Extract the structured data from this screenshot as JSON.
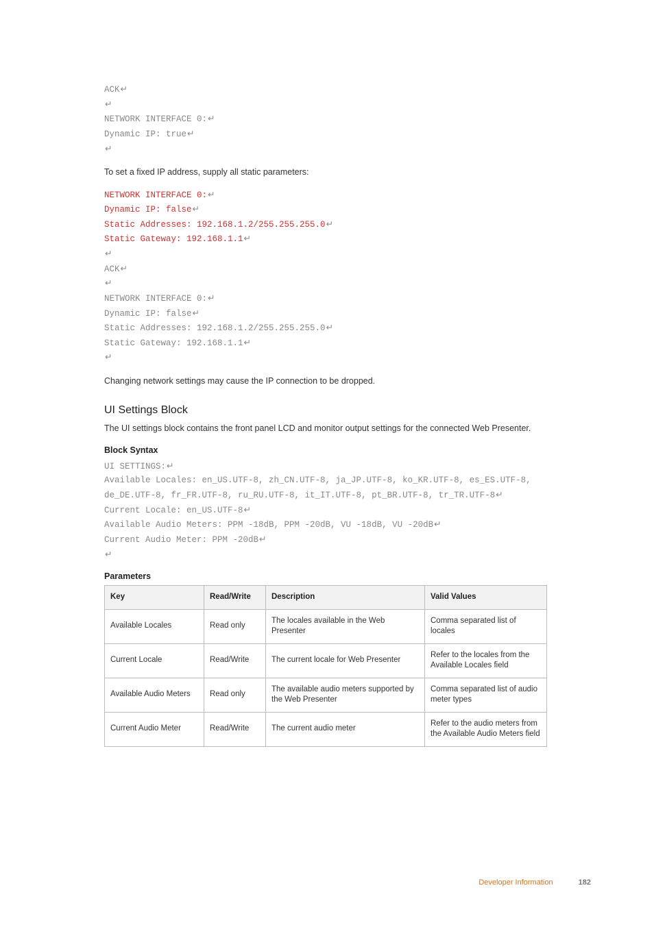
{
  "code_block_1": [
    {
      "text": "ACK",
      "cr": true
    },
    {
      "text": "",
      "cr": true
    },
    {
      "text": "NETWORK INTERFACE 0:",
      "cr": true
    },
    {
      "text": "Dynamic IP: true",
      "cr": true
    },
    {
      "text": "",
      "cr": true
    }
  ],
  "para_1": "To set a fixed IP address, supply all static parameters:",
  "code_block_2": [
    {
      "text": "NETWORK INTERFACE 0:",
      "cr": true,
      "red": true
    },
    {
      "text": "Dynamic IP: false",
      "cr": true,
      "red": true
    },
    {
      "text": "Static Addresses: 192.168.1.2/255.255.255.0",
      "cr": true,
      "red": true
    },
    {
      "text": "Static Gateway: 192.168.1.1",
      "cr": true,
      "red": true
    },
    {
      "text": "",
      "cr": true,
      "red": true
    },
    {
      "text": "ACK",
      "cr": true
    },
    {
      "text": "",
      "cr": true
    },
    {
      "text": "NETWORK INTERFACE 0:",
      "cr": true
    },
    {
      "text": "Dynamic IP: false",
      "cr": true
    },
    {
      "text": "Static Addresses: 192.168.1.2/255.255.255.0",
      "cr": true
    },
    {
      "text": "Static Gateway: 192.168.1.1",
      "cr": true
    },
    {
      "text": "",
      "cr": true
    }
  ],
  "para_2": "Changing network settings may cause the IP connection to be dropped.",
  "heading_ui": "UI Settings Block",
  "para_3": "The UI settings block contains the front panel LCD and monitor output settings for the connected Web Presenter.",
  "block_syntax_label": "Block Syntax",
  "code_block_3": [
    {
      "text": "UI SETTINGS:",
      "cr": true
    },
    {
      "text": "Available Locales: en_US.UTF-8, zh_CN.UTF-8, ja_JP.UTF-8, ko_KR.UTF-8, es_ES.UTF-8, de_DE.UTF-8, fr_FR.UTF-8, ru_RU.UTF-8, it_IT.UTF-8, pt_BR.UTF-8, tr_TR.UTF-8",
      "cr": true
    },
    {
      "text": "Current Locale: en_US.UTF-8",
      "cr": true
    },
    {
      "text": "Available Audio Meters: PPM -18dB, PPM -20dB, VU -18dB, VU -20dB",
      "cr": true
    },
    {
      "text": "Current Audio Meter: PPM -20dB",
      "cr": true
    },
    {
      "text": "",
      "cr": true
    }
  ],
  "parameters_label": "Parameters",
  "table": {
    "headers": [
      "Key",
      "Read/Write",
      "Description",
      "Valid Values"
    ],
    "rows": [
      [
        "Available Locales",
        "Read only",
        "The locales available in the Web Presenter",
        "Comma separated list of locales"
      ],
      [
        "Current Locale",
        "Read/Write",
        "The current locale for Web Presenter",
        "Refer to the locales from the Available Locales field"
      ],
      [
        "Available Audio Meters",
        "Read only",
        "The available audio meters supported by the Web Presenter",
        "Comma separated list of audio meter types"
      ],
      [
        "Current Audio Meter",
        "Read/Write",
        "The current audio meter",
        "Refer to the audio meters from the Available Audio Meters field"
      ]
    ]
  },
  "footer": {
    "section": "Developer Information",
    "page": "182"
  },
  "cr_glyph": "↵"
}
